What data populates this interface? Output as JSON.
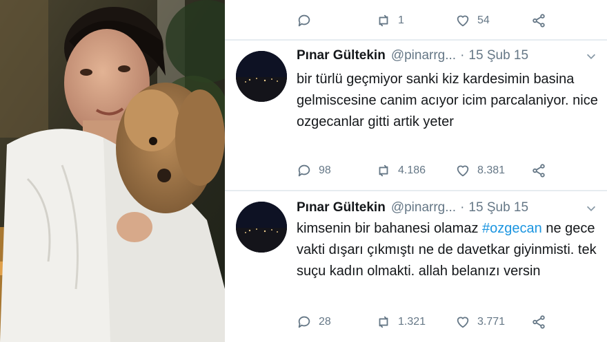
{
  "top_actions": {
    "replies": "",
    "retweets": "1",
    "likes": "54"
  },
  "tweets": [
    {
      "name": "Pınar Gültekin",
      "handle": "@pinarrg...",
      "separator": "·",
      "date": "15 Şub 15",
      "text": "bir türlü geçmiyor sanki kiz kardesimin basina gelmiscesine canim acıyor icim parcalaniyor. nice ozgecanlar gitti artik yeter",
      "replies": "98",
      "retweets": "4.186",
      "likes": "8.381"
    },
    {
      "name": "Pınar Gültekin",
      "handle": "@pinarrg...",
      "separator": "·",
      "date": "15 Şub 15",
      "text_before": "kimsenin bir bahanesi olamaz ",
      "hashtag": "#ozgecan",
      "text_after": " ne gece vakti dışarı çıkmıştı ne de davetkar giyinmisti. tek suçu kadın olmakti. allah belanızı versin",
      "replies": "28",
      "retweets": "1.321",
      "likes": "3.771"
    }
  ],
  "colors": {
    "muted": "#657786",
    "text": "#14171a",
    "link": "#1b95e0",
    "divider": "#e6ecf0"
  }
}
